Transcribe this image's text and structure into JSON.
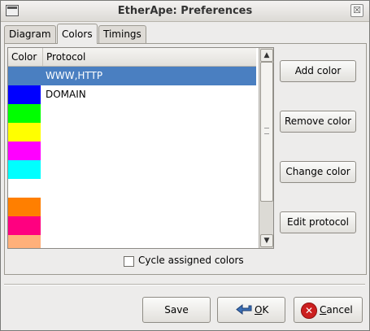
{
  "window": {
    "title": "EtherApe: Preferences",
    "close_glyph": "☒"
  },
  "tabs": [
    {
      "label": "Diagram",
      "active": false
    },
    {
      "label": "Colors",
      "active": true
    },
    {
      "label": "Timings",
      "active": false
    }
  ],
  "table": {
    "columns": [
      "Color",
      "Protocol"
    ],
    "rows": [
      {
        "color": "#4a7fc1",
        "protocol": "WWW,HTTP",
        "selected": true
      },
      {
        "color": "#0000ff",
        "protocol": "DOMAIN"
      },
      {
        "color": "#00ff00",
        "protocol": ""
      },
      {
        "color": "#ffff00",
        "protocol": ""
      },
      {
        "color": "#ff00ff",
        "protocol": ""
      },
      {
        "color": "#00ffff",
        "protocol": ""
      },
      {
        "color": "#ffffff",
        "protocol": ""
      },
      {
        "color": "#ff7f00",
        "protocol": ""
      },
      {
        "color": "#ff0080",
        "protocol": ""
      },
      {
        "color": "#ffb07a",
        "protocol": ""
      }
    ]
  },
  "side_buttons": {
    "add": "Add color",
    "remove": "Remove color",
    "change": "Change color",
    "edit": "Edit protocol"
  },
  "cycle_checkbox": {
    "label": "Cycle assigned colors",
    "checked": false
  },
  "footer": {
    "save": "Save",
    "ok_underline": "O",
    "ok_rest": "K",
    "cancel_underline": "C",
    "cancel_rest": "ancel"
  },
  "colors": {
    "selection": "#4a7fc1",
    "cancel_icon": "#cc1f1f",
    "ok_icon": "#3b6fb6"
  },
  "icons": {
    "window_menu": "window-menu-icon",
    "close": "close-icon",
    "ok": "ok-arrow-icon",
    "cancel": "cancel-icon",
    "scroll_up": "scroll-up-icon",
    "scroll_down": "scroll-down-icon"
  }
}
